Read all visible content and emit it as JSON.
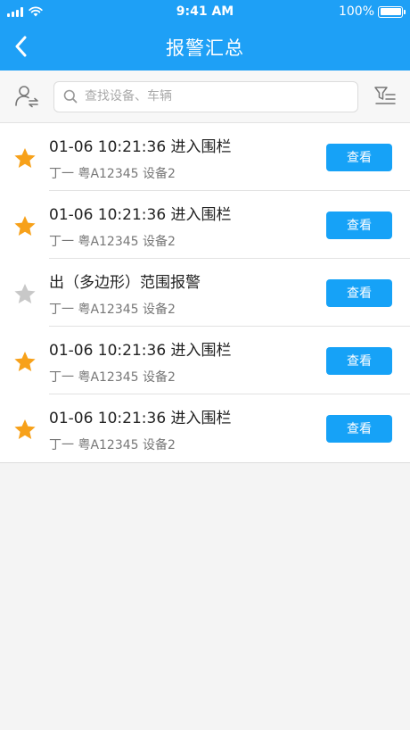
{
  "status_bar": {
    "time": "9:41 AM",
    "battery": "100%",
    "battery_level": 1.0
  },
  "nav": {
    "title": "报警汇总"
  },
  "search": {
    "placeholder": "查找设备、车辆"
  },
  "items": [
    {
      "starred": true,
      "title": "01-06 10:21:36  进入围栏",
      "subtitle": "丁一 粤A12345 设备2",
      "button": "查看"
    },
    {
      "starred": true,
      "title": "01-06 10:21:36  进入围栏",
      "subtitle": "丁一 粤A12345 设备2",
      "button": "查看"
    },
    {
      "starred": false,
      "title": "出（多边形）范围报警",
      "subtitle": "丁一 粤A12345 设备2",
      "button": "查看"
    },
    {
      "starred": true,
      "title": "01-06 10:21:36  进入围栏",
      "subtitle": "丁一 粤A12345 设备2",
      "button": "查看"
    },
    {
      "starred": true,
      "title": "01-06 10:21:36  进入围栏",
      "subtitle": "丁一 粤A12345 设备2",
      "button": "查看"
    }
  ],
  "colors": {
    "primary": "#1ea0f6",
    "star_active": "#f7a11a",
    "star_inactive": "#c8c8c8"
  },
  "icons": {
    "back": "chevron-left-icon",
    "user_switch": "user-switch-icon",
    "search": "search-icon",
    "filter": "filter-icon",
    "star": "star-icon"
  }
}
